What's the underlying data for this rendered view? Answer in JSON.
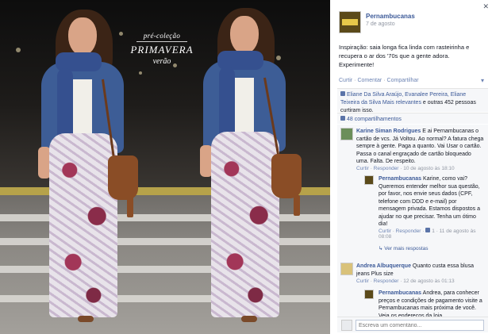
{
  "promo": {
    "pre_label": "pré-coleção",
    "collection": "PRIMAVERA",
    "season": "verão"
  },
  "post": {
    "page_name": "Pernambucanas",
    "date": "7 de agosto",
    "caption": "Inspiração: saia longa fica linda com rasteirinha e recupera o ar dos '70s que a gente adora. Experimente!",
    "actions": {
      "like": "Curtir",
      "comment": "Comentar",
      "share": "Compartilhar"
    },
    "likes_text_names": "Eliane Da Silva Araújo, Evanalee Pereira, Eliane Teixeira da Silva",
    "likes_text_more": "Mais relevantes",
    "likes_text_rest": "e outras 452 pessoas curtiram isso.",
    "shares": "48 compartilhamentos"
  },
  "comments": [
    {
      "author": "Karine Siman Rodrigues",
      "text": "E ai Pernambucanas o cartão de vcs. Já Voltou. Ao normal? A fatura chega sempre à gente. Paga a quanto. Vai Usar o cartão. Passa o canal engraçado de cartão bloqueado uma. Falta. De respeito.",
      "like": "Curtir",
      "reply": "Responder",
      "date": "10 de agosto às 18:10"
    },
    {
      "author": "Pernambucanas",
      "text": "Karine, como vai? Queremos entender melhor sua questão, por favor, nos envie seus dados (CPF, telefone com DDD e e-mail) por mensagem privada. Estamos dispostos a ajudar no que precisar. Tenha um ótimo dia!",
      "like": "Curtir",
      "reply": "Responder",
      "likes": "1",
      "date": "11 de agosto às 08:08"
    },
    {
      "author": "Andrea Albuquerque",
      "text": "Quanto custa essa blusa jeans Plus size",
      "like": "Curtir",
      "reply": "Responder",
      "date": "12 de agosto às 01:13"
    },
    {
      "author": "Pernambucanas",
      "text": "Andrea, para conhecer preços e condições de pagamento visite a Pernambucanas mais próxima de você. Veja os endereços da loja..."
    }
  ],
  "more_replies": "Ver mais respostas",
  "comment_input_placeholder": "Escreva um comentário...",
  "close_symbol": "✕",
  "share_menu_symbol": "▾"
}
